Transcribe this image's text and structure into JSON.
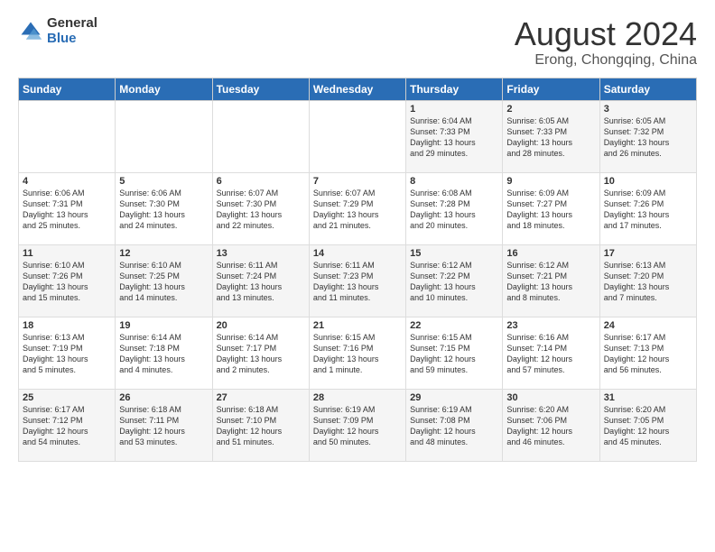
{
  "logo": {
    "general": "General",
    "blue": "Blue"
  },
  "title": "August 2024",
  "subtitle": "Erong, Chongqing, China",
  "weekdays": [
    "Sunday",
    "Monday",
    "Tuesday",
    "Wednesday",
    "Thursday",
    "Friday",
    "Saturday"
  ],
  "weeks": [
    [
      {
        "day": "",
        "info": ""
      },
      {
        "day": "",
        "info": ""
      },
      {
        "day": "",
        "info": ""
      },
      {
        "day": "",
        "info": ""
      },
      {
        "day": "1",
        "info": "Sunrise: 6:04 AM\nSunset: 7:33 PM\nDaylight: 13 hours\nand 29 minutes."
      },
      {
        "day": "2",
        "info": "Sunrise: 6:05 AM\nSunset: 7:33 PM\nDaylight: 13 hours\nand 28 minutes."
      },
      {
        "day": "3",
        "info": "Sunrise: 6:05 AM\nSunset: 7:32 PM\nDaylight: 13 hours\nand 26 minutes."
      }
    ],
    [
      {
        "day": "4",
        "info": "Sunrise: 6:06 AM\nSunset: 7:31 PM\nDaylight: 13 hours\nand 25 minutes."
      },
      {
        "day": "5",
        "info": "Sunrise: 6:06 AM\nSunset: 7:30 PM\nDaylight: 13 hours\nand 24 minutes."
      },
      {
        "day": "6",
        "info": "Sunrise: 6:07 AM\nSunset: 7:30 PM\nDaylight: 13 hours\nand 22 minutes."
      },
      {
        "day": "7",
        "info": "Sunrise: 6:07 AM\nSunset: 7:29 PM\nDaylight: 13 hours\nand 21 minutes."
      },
      {
        "day": "8",
        "info": "Sunrise: 6:08 AM\nSunset: 7:28 PM\nDaylight: 13 hours\nand 20 minutes."
      },
      {
        "day": "9",
        "info": "Sunrise: 6:09 AM\nSunset: 7:27 PM\nDaylight: 13 hours\nand 18 minutes."
      },
      {
        "day": "10",
        "info": "Sunrise: 6:09 AM\nSunset: 7:26 PM\nDaylight: 13 hours\nand 17 minutes."
      }
    ],
    [
      {
        "day": "11",
        "info": "Sunrise: 6:10 AM\nSunset: 7:26 PM\nDaylight: 13 hours\nand 15 minutes."
      },
      {
        "day": "12",
        "info": "Sunrise: 6:10 AM\nSunset: 7:25 PM\nDaylight: 13 hours\nand 14 minutes."
      },
      {
        "day": "13",
        "info": "Sunrise: 6:11 AM\nSunset: 7:24 PM\nDaylight: 13 hours\nand 13 minutes."
      },
      {
        "day": "14",
        "info": "Sunrise: 6:11 AM\nSunset: 7:23 PM\nDaylight: 13 hours\nand 11 minutes."
      },
      {
        "day": "15",
        "info": "Sunrise: 6:12 AM\nSunset: 7:22 PM\nDaylight: 13 hours\nand 10 minutes."
      },
      {
        "day": "16",
        "info": "Sunrise: 6:12 AM\nSunset: 7:21 PM\nDaylight: 13 hours\nand 8 minutes."
      },
      {
        "day": "17",
        "info": "Sunrise: 6:13 AM\nSunset: 7:20 PM\nDaylight: 13 hours\nand 7 minutes."
      }
    ],
    [
      {
        "day": "18",
        "info": "Sunrise: 6:13 AM\nSunset: 7:19 PM\nDaylight: 13 hours\nand 5 minutes."
      },
      {
        "day": "19",
        "info": "Sunrise: 6:14 AM\nSunset: 7:18 PM\nDaylight: 13 hours\nand 4 minutes."
      },
      {
        "day": "20",
        "info": "Sunrise: 6:14 AM\nSunset: 7:17 PM\nDaylight: 13 hours\nand 2 minutes."
      },
      {
        "day": "21",
        "info": "Sunrise: 6:15 AM\nSunset: 7:16 PM\nDaylight: 13 hours\nand 1 minute."
      },
      {
        "day": "22",
        "info": "Sunrise: 6:15 AM\nSunset: 7:15 PM\nDaylight: 12 hours\nand 59 minutes."
      },
      {
        "day": "23",
        "info": "Sunrise: 6:16 AM\nSunset: 7:14 PM\nDaylight: 12 hours\nand 57 minutes."
      },
      {
        "day": "24",
        "info": "Sunrise: 6:17 AM\nSunset: 7:13 PM\nDaylight: 12 hours\nand 56 minutes."
      }
    ],
    [
      {
        "day": "25",
        "info": "Sunrise: 6:17 AM\nSunset: 7:12 PM\nDaylight: 12 hours\nand 54 minutes."
      },
      {
        "day": "26",
        "info": "Sunrise: 6:18 AM\nSunset: 7:11 PM\nDaylight: 12 hours\nand 53 minutes."
      },
      {
        "day": "27",
        "info": "Sunrise: 6:18 AM\nSunset: 7:10 PM\nDaylight: 12 hours\nand 51 minutes."
      },
      {
        "day": "28",
        "info": "Sunrise: 6:19 AM\nSunset: 7:09 PM\nDaylight: 12 hours\nand 50 minutes."
      },
      {
        "day": "29",
        "info": "Sunrise: 6:19 AM\nSunset: 7:08 PM\nDaylight: 12 hours\nand 48 minutes."
      },
      {
        "day": "30",
        "info": "Sunrise: 6:20 AM\nSunset: 7:06 PM\nDaylight: 12 hours\nand 46 minutes."
      },
      {
        "day": "31",
        "info": "Sunrise: 6:20 AM\nSunset: 7:05 PM\nDaylight: 12 hours\nand 45 minutes."
      }
    ]
  ]
}
